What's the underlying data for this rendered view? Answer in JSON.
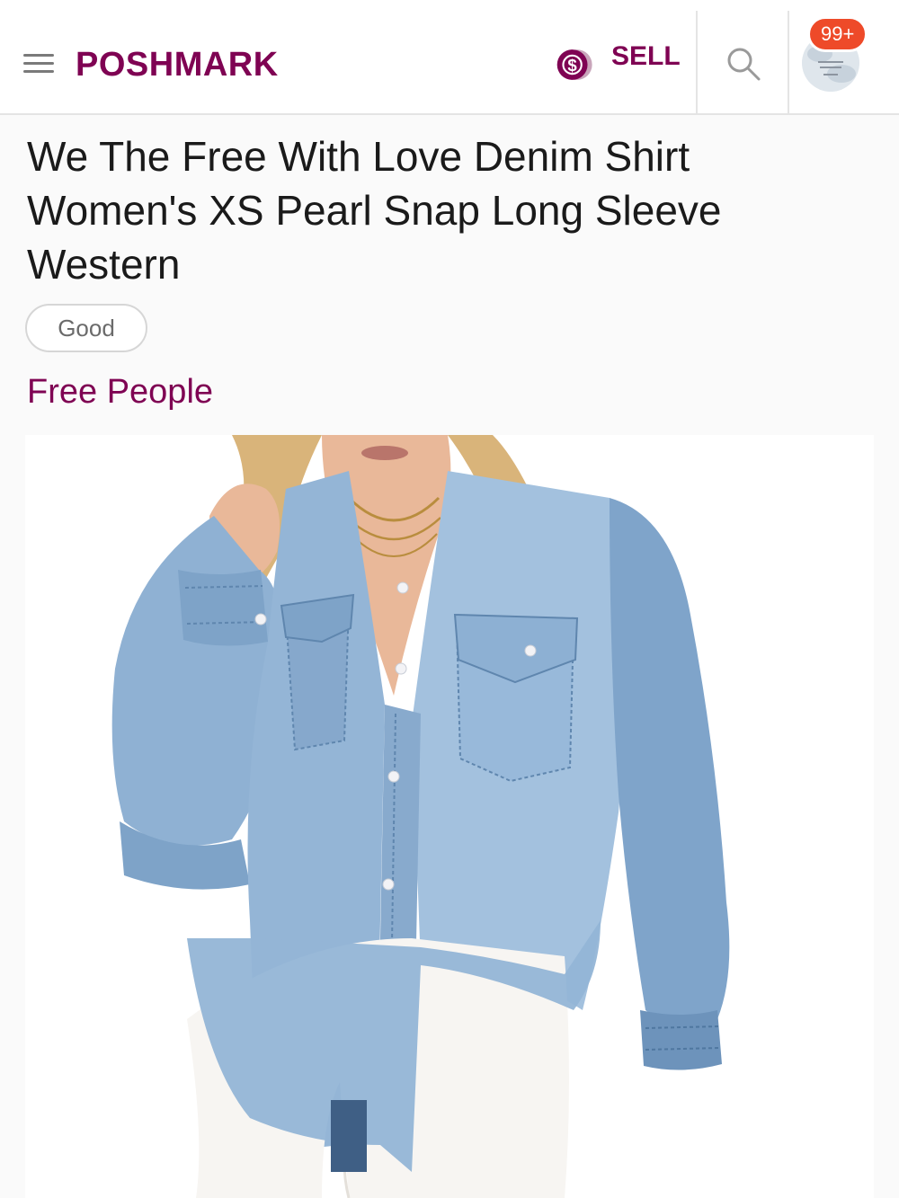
{
  "header": {
    "menu_icon": "hamburger-menu-icon",
    "logo": "POSHMARK",
    "sell_label": "SELL",
    "sell_icon": "dollar-coin-icon",
    "search_icon": "search-icon",
    "notification_badge": "99+",
    "avatar_icon": "user-avatar-icon"
  },
  "listing": {
    "title": "We The Free With Love Denim Shirt Women's XS Pearl Snap Long Sleeve Western",
    "condition": "Good",
    "brand": "Free People",
    "image_alt_icon": "product-photo-denim-shirt"
  },
  "colors": {
    "brand": "#7f0353",
    "badge": "#ee4a29",
    "denim": "#8fb1d3",
    "denim_dark": "#6d93bb",
    "text": "#1a1a1a"
  }
}
